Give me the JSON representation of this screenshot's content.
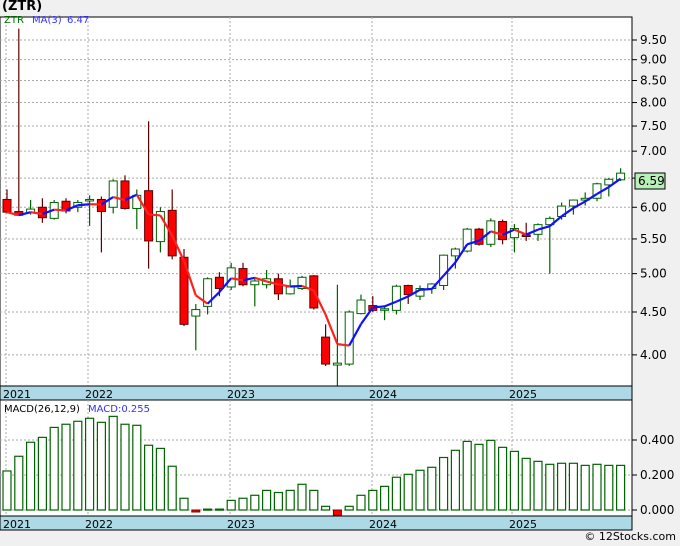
{
  "title": "(ZTR)",
  "footer": "© 12Stocks.com",
  "legend": {
    "symbol": "ZTR",
    "ma_label": "MA(3)",
    "ma_value": "6.47",
    "macd_label": "MACD(26,12,9)",
    "macd_value": "MACD:0.255"
  },
  "last_price_badge": "6.59",
  "colors": {
    "up": "#006400",
    "down": "#ff0000",
    "ma_up": "#1010ff",
    "ma_down": "#ff2020",
    "date_strip": "#add8e6",
    "badge": "#b8f0b8"
  },
  "chart_data": [
    {
      "type": "candlestick",
      "scale": "log",
      "ylim": [
        3.67,
        9.9
      ],
      "grid": true,
      "y_ticks": [
        "9.50",
        "9.00",
        "8.50",
        "8.00",
        "7.50",
        "7.00",
        "6.00",
        "5.50",
        "5.00",
        "4.50",
        "4.00"
      ],
      "y_tick_values": [
        9.5,
        9,
        8.5,
        8,
        7.5,
        7,
        6,
        5.5,
        5,
        4.5,
        4
      ],
      "hidden_grid_values": [
        6.5
      ],
      "x_ticks": [
        "2021",
        "2022",
        "2023",
        "2024",
        "2025"
      ],
      "x_tick_bar_index": [
        0,
        7,
        19,
        31,
        43
      ],
      "indicator": "MA(3)",
      "ohlc": [
        [
          6.13,
          6.3,
          5.9,
          5.92
        ],
        [
          5.93,
          9.8,
          5.86,
          5.87
        ],
        [
          5.91,
          6.12,
          5.88,
          5.97
        ],
        [
          6.0,
          6.15,
          5.75,
          5.83
        ],
        [
          5.82,
          6.12,
          5.8,
          6.08
        ],
        [
          6.1,
          6.15,
          5.9,
          5.94
        ],
        [
          6.0,
          6.12,
          5.92,
          6.08
        ],
        [
          6.13,
          6.2,
          5.7,
          6.13
        ],
        [
          6.13,
          6.18,
          5.3,
          5.93
        ],
        [
          6.0,
          6.48,
          5.9,
          6.45
        ],
        [
          6.45,
          6.55,
          5.96,
          5.98
        ],
        [
          5.98,
          6.3,
          5.65,
          6.2
        ],
        [
          6.28,
          7.6,
          5.07,
          5.47
        ],
        [
          5.46,
          6.0,
          5.3,
          5.93
        ],
        [
          5.95,
          6.3,
          5.2,
          5.25
        ],
        [
          5.23,
          5.35,
          4.33,
          4.35
        ],
        [
          4.45,
          4.6,
          4.05,
          4.53
        ],
        [
          4.57,
          4.95,
          4.47,
          4.93
        ],
        [
          4.95,
          5.02,
          4.7,
          4.8
        ],
        [
          4.82,
          5.15,
          4.78,
          5.08
        ],
        [
          5.07,
          5.15,
          4.83,
          4.85
        ],
        [
          4.85,
          4.95,
          4.57,
          4.9
        ],
        [
          4.85,
          5.05,
          4.8,
          4.93
        ],
        [
          4.93,
          5.0,
          4.65,
          4.73
        ],
        [
          4.73,
          4.92,
          4.72,
          4.82
        ],
        [
          4.8,
          4.97,
          4.78,
          4.95
        ],
        [
          4.97,
          4.98,
          4.53,
          4.55
        ],
        [
          4.2,
          4.35,
          3.88,
          3.9
        ],
        [
          3.89,
          4.85,
          3.67,
          3.91
        ],
        [
          3.9,
          4.52,
          3.88,
          4.5
        ],
        [
          4.48,
          4.72,
          4.47,
          4.65
        ],
        [
          4.58,
          4.7,
          4.5,
          4.52
        ],
        [
          4.53,
          4.57,
          4.4,
          4.54
        ],
        [
          4.52,
          4.85,
          4.47,
          4.83
        ],
        [
          4.84,
          4.85,
          4.6,
          4.72
        ],
        [
          4.7,
          4.84,
          4.65,
          4.8
        ],
        [
          4.8,
          4.87,
          4.73,
          4.86
        ],
        [
          4.84,
          5.27,
          4.78,
          5.26
        ],
        [
          5.25,
          5.37,
          5.07,
          5.35
        ],
        [
          5.32,
          5.67,
          5.3,
          5.65
        ],
        [
          5.65,
          5.67,
          5.4,
          5.42
        ],
        [
          5.42,
          5.82,
          5.38,
          5.78
        ],
        [
          5.77,
          5.8,
          5.42,
          5.49
        ],
        [
          5.52,
          5.73,
          5.3,
          5.66
        ],
        [
          5.56,
          5.75,
          5.47,
          5.55
        ],
        [
          5.57,
          5.74,
          5.47,
          5.72
        ],
        [
          5.72,
          5.85,
          5.0,
          5.82
        ],
        [
          5.85,
          6.08,
          5.8,
          6.02
        ],
        [
          6.02,
          6.13,
          5.88,
          6.12
        ],
        [
          6.12,
          6.25,
          6.03,
          6.15
        ],
        [
          6.15,
          6.42,
          6.1,
          6.4
        ],
        [
          6.38,
          6.5,
          6.18,
          6.48
        ],
        [
          6.47,
          6.68,
          6.45,
          6.59
        ]
      ]
    },
    {
      "type": "bar",
      "title": "MACD(26,12,9)",
      "ylim": [
        -0.04,
        0.62
      ],
      "y_ticks": [
        "0.400",
        "0.200",
        "0.000"
      ],
      "y_tick_values": [
        0.4,
        0.2,
        0
      ],
      "x_ticks": [
        "2021",
        "2022",
        "2023",
        "2024",
        "2025"
      ],
      "values": [
        0.223,
        0.307,
        0.387,
        0.415,
        0.472,
        0.49,
        0.507,
        0.524,
        0.501,
        0.535,
        0.49,
        0.484,
        0.37,
        0.352,
        0.25,
        0.067,
        -0.01,
        0.005,
        0.005,
        0.055,
        0.067,
        0.084,
        0.112,
        0.1,
        0.112,
        0.147,
        0.112,
        0.021,
        -0.03,
        0.021,
        0.084,
        0.112,
        0.135,
        0.187,
        0.204,
        0.227,
        0.244,
        0.3,
        0.341,
        0.392,
        0.375,
        0.398,
        0.358,
        0.335,
        0.295,
        0.278,
        0.261,
        0.267,
        0.267,
        0.255,
        0.261,
        0.255,
        0.255
      ]
    }
  ]
}
